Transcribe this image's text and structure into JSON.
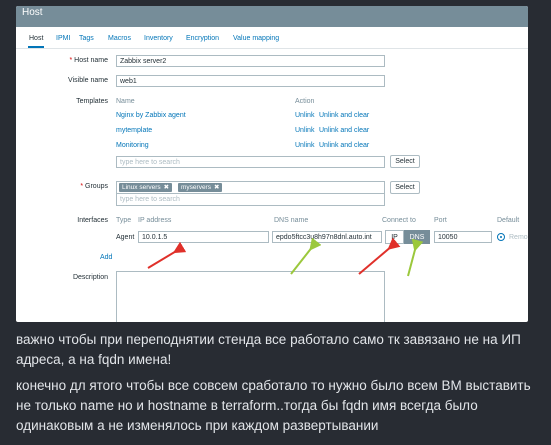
{
  "dialog": {
    "title": "Host",
    "tabs": [
      "Host",
      "IPMI",
      "Tags",
      "Macros",
      "Inventory",
      "Encryption",
      "Value mapping"
    ]
  },
  "form": {
    "host_name_label": "Host name",
    "host_name_value": "Zabbix server2",
    "visible_name_label": "Visible name",
    "visible_name_value": "web1",
    "templates_label": "Templates",
    "templates_col_name": "Name",
    "templates_col_action": "Action",
    "templates": [
      {
        "name": "Nginx by Zabbix agent",
        "unlink": "Unlink",
        "unlink_clear": "Unlink and clear"
      },
      {
        "name": "mytemplate",
        "unlink": "Unlink",
        "unlink_clear": "Unlink and clear"
      },
      {
        "name": "Monitoring",
        "unlink": "Unlink",
        "unlink_clear": "Unlink and clear"
      }
    ],
    "search_placeholder": "type here to search",
    "select_label": "Select",
    "groups_label": "Groups",
    "groups": [
      "Linux servers",
      "myservers"
    ],
    "interfaces_label": "Interfaces",
    "iface_headers": {
      "type": "Type",
      "ip": "IP address",
      "dns": "DNS name",
      "connect_to": "Connect to",
      "port": "Port",
      "default": "Default"
    },
    "interface": {
      "type": "Agent",
      "ip": "10.0.1.5",
      "dns": "epdo5ftcc3u8h97n8dnl.auto.int",
      "ip_btn": "IP",
      "dns_btn": "DNS",
      "port": "10050",
      "remove": "Remo"
    },
    "add_label": "Add",
    "description_label": "Description"
  },
  "annotation_colors": {
    "red": "#e0302a",
    "green": "#9bc83c"
  },
  "messages": [
    "важно чтобы при переподнятии стенда все работало само тк завязано не на ИП адреса, а на fqdn имена!",
    "конечно дл ятого чтобы все совсем сработало то нужно было всем ВМ выставить не только name но и hostname в terraform..тогда бы fqdn имя всегда было одинаковым а не изменялось при каждом развертывании"
  ]
}
